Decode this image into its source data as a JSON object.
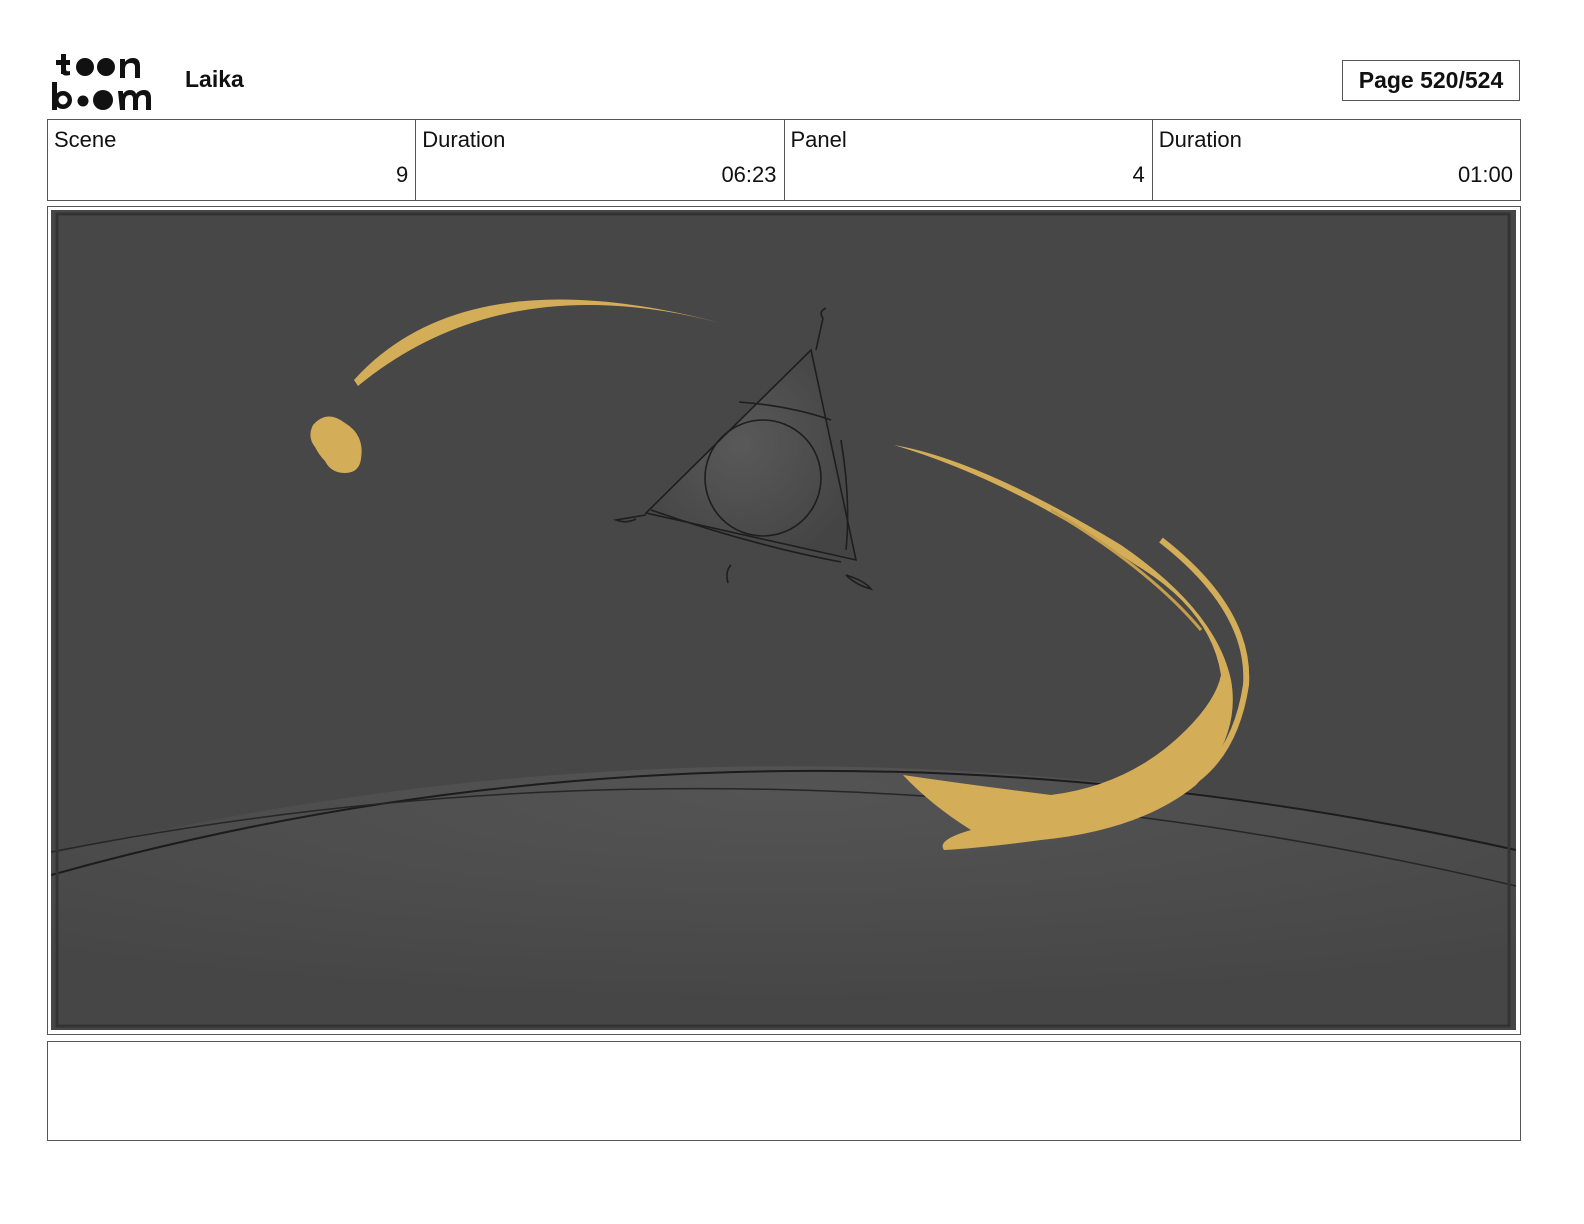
{
  "header": {
    "logo_alt": "toon boom",
    "project": "Laika",
    "page": "Page 520/524"
  },
  "info": {
    "scene_label": "Scene",
    "scene_value": "9",
    "scene_duration_label": "Duration",
    "scene_duration_value": "06:23",
    "panel_label": "Panel",
    "panel_value": "4",
    "panel_duration_label": "Duration",
    "panel_duration_value": "01:00"
  },
  "colors": {
    "panel_bg": "#474747",
    "ground": "#4e4e4e",
    "streak": "#d4ad58",
    "line": "#1c1c1c"
  },
  "notes": ""
}
